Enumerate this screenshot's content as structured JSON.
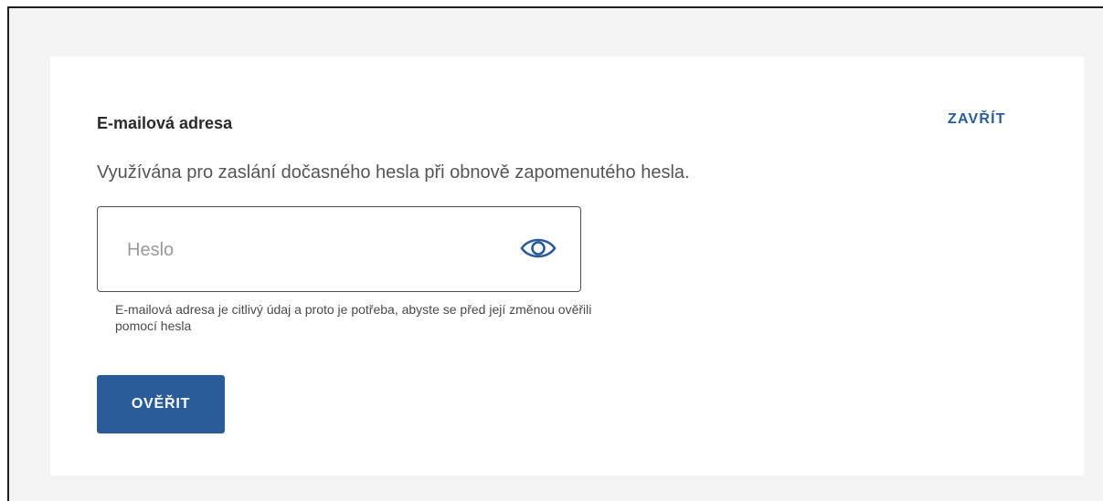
{
  "section": {
    "title": "E-mailová adresa",
    "close_label": "ZAVŘÍT",
    "description": "Využívána pro zaslání dočasného hesla při obnově zapomenutého hesla."
  },
  "password": {
    "placeholder": "Heslo",
    "value": "",
    "toggle_icon": "eye-icon",
    "helper_text": "E-mailová adresa je citlivý údaj a proto je potřeba, abyste se před její změnou ověřili pomocí hesla"
  },
  "actions": {
    "verify_label": "OVĚŘIT"
  },
  "colors": {
    "accent": "#2a5c9a",
    "page_background": "#f4f4f4",
    "card_background": "#ffffff"
  }
}
